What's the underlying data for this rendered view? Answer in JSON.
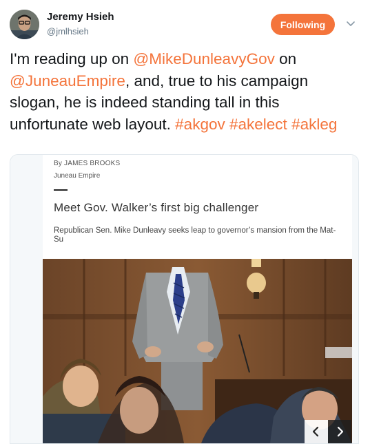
{
  "author": {
    "name": "Jeremy Hsieh",
    "handle": "@jmlhsieh",
    "avatar_icon": "user-avatar-icon"
  },
  "actions": {
    "follow_label": "Following",
    "more_icon": "chevron-down-icon"
  },
  "tweet": {
    "t1": "I'm reading up on ",
    "m1": "@MikeDunleavyGov",
    "t2": " on ",
    "m2": "@JuneauEmpire",
    "t3": ", and, true to his campaign slogan, he is indeed standing tall in this unfortunate web  layout. ",
    "h1": "#akgov",
    "h2": "#akelect",
    "h3": "#akleg"
  },
  "card": {
    "byline": "By JAMES BROOKS",
    "source": "Juneau Empire",
    "headline": "Meet Gov. Walker’s first big challenger",
    "subhead": "Republican Sen. Mike Dunleavy seeks leap to governor’s mansion from the Mat-Su",
    "prev_icon": "chevron-left-icon",
    "next_icon": "chevron-right-icon"
  },
  "colors": {
    "accent": "#f4743b",
    "text": "#14171a",
    "muted": "#657786"
  }
}
